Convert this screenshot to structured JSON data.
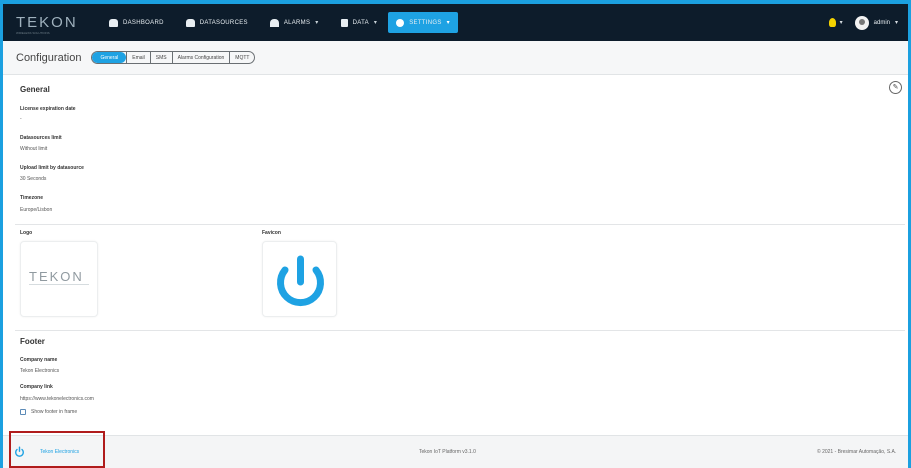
{
  "brand": {
    "logo_text": "TEKON",
    "logo_sub": "WIRELESS SOLUTIONS"
  },
  "nav": {
    "items": [
      {
        "label": "DASHBOARD",
        "icon": "dashboard-icon",
        "caret": ""
      },
      {
        "label": "DATASOURCES",
        "icon": "car-icon",
        "caret": ""
      },
      {
        "label": "ALARMS",
        "icon": "bell-icon",
        "caret": "▾"
      },
      {
        "label": "DATA",
        "icon": "database-icon",
        "caret": "▾"
      },
      {
        "label": "SETTINGS",
        "icon": "gear-icon",
        "caret": "▾",
        "active": true
      }
    ]
  },
  "user": {
    "name": "admin",
    "caret": "▾",
    "bulb_caret": "▾"
  },
  "header": {
    "title": "Configuration",
    "tabs": [
      "General",
      "Email",
      "SMS",
      "Alarms Configuration",
      "MQTT"
    ]
  },
  "general": {
    "title": "General",
    "license_label": "License expiration date",
    "license_value": "-",
    "datasources_label": "Datasources limit",
    "datasources_value": "Without limit",
    "upload_label": "Upload limit by datasource",
    "upload_value": "30 Seconds",
    "timezone_label": "Timezone",
    "timezone_value": "Europe/Lisbon",
    "edit_icon": "✎"
  },
  "images": {
    "logo_label": "Logo",
    "favicon_label": "Favicon",
    "logo_text": "TEKON"
  },
  "footer_section": {
    "title": "Footer",
    "company_name_label": "Company name",
    "company_name_value": "Tekon Electronics",
    "company_link_label": "Company link",
    "company_link_value": "https://www.tekonelectronics.com",
    "show_footer_label": "Show footer in frame"
  },
  "page_footer": {
    "left_text": "Tekon Electronics",
    "center_text": "Tekon IoT Platform v3.1.0",
    "right_text": "© 2021 - Bresimar Automação, S.A."
  },
  "colors": {
    "accent": "#1ea2e3",
    "topbar": "#0d1c2b",
    "highlight": "#b01c1c"
  }
}
